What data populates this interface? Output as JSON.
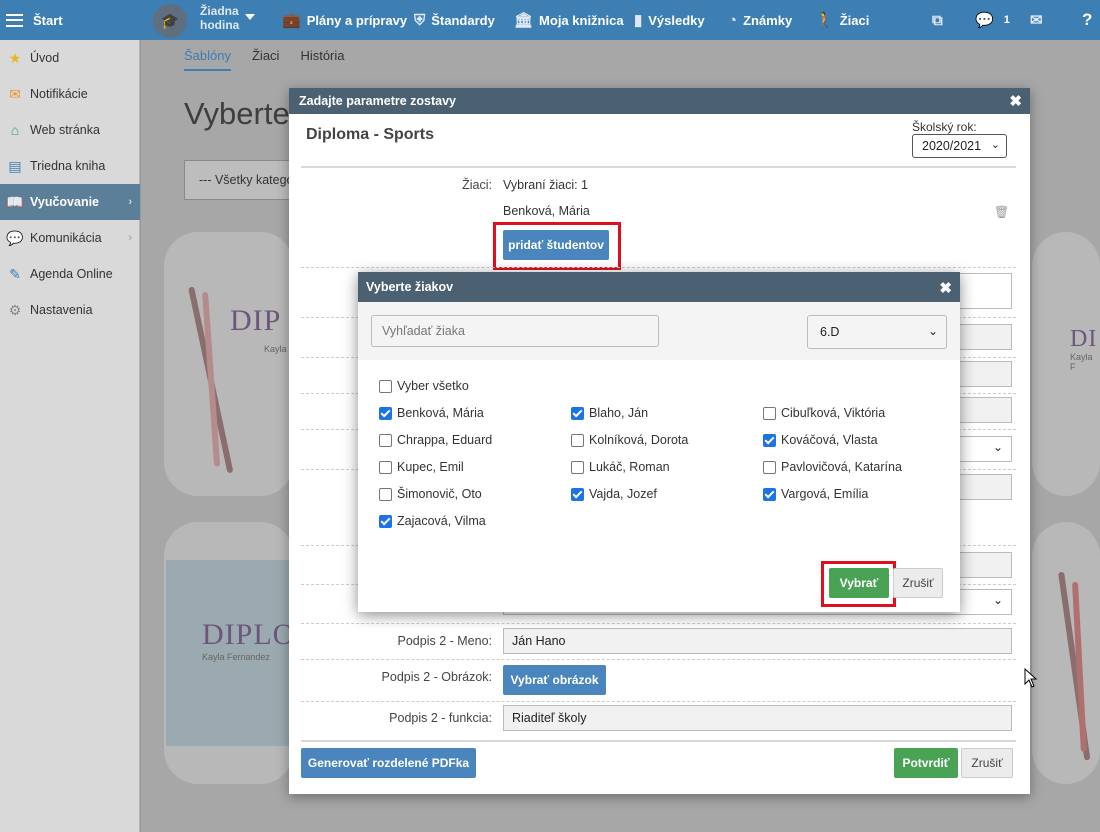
{
  "topbar": {
    "start": "Štart",
    "hodina": "Žiadna hodina",
    "items": [
      {
        "label": "Plány a prípravy",
        "icon": "briefcase-icon"
      },
      {
        "label": "Štandardy",
        "icon": "shield-icon"
      },
      {
        "label": "Moja knižnica",
        "icon": "library-icon"
      },
      {
        "label": "Výsledky",
        "icon": "bar-chart-icon"
      },
      {
        "label": "Známky",
        "icon": "grades-icon"
      },
      {
        "label": "Žiaci",
        "icon": "students-icon"
      }
    ],
    "messages_count": "1",
    "help": "?"
  },
  "sidebar": {
    "items": [
      {
        "label": "Úvod",
        "icon": "star-icon"
      },
      {
        "label": "Notifikácie",
        "icon": "envelope-icon"
      },
      {
        "label": "Web stránka",
        "icon": "home-icon"
      },
      {
        "label": "Triedna kniha",
        "icon": "book-icon"
      },
      {
        "label": "Vyučovanie",
        "icon": "open-book-icon",
        "active": true
      },
      {
        "label": "Komunikácia",
        "icon": "chat-icon"
      },
      {
        "label": "Agenda Online",
        "icon": "pen-icon"
      },
      {
        "label": "Nastavenia",
        "icon": "gear-icon"
      }
    ]
  },
  "page": {
    "tabs": [
      "Šablóny",
      "Žiaci",
      "História"
    ],
    "title": "Vyberte",
    "category_select": "--- Všetky kategó"
  },
  "cards": {
    "dip_text": "DIPLO",
    "dip_text_short": "DIP",
    "dip_text_right": "DI",
    "name_text": "Kayla Fernandez",
    "name_short": "Kayla",
    "name_right": "Kayla F"
  },
  "modal": {
    "header": "Zadajte parametre zostavy",
    "title": "Diploma - Sports",
    "year_label": "Školský rok:",
    "year_value": "2020/2021",
    "students_label": "Žiaci:",
    "students_selected": "Vybraní žiaci: 1",
    "student_name": "Benková, Mária",
    "add_students": "pridať študentov",
    "sig2_name_label": "Podpis 2 - Meno:",
    "sig2_name_value": "Ján Hano",
    "sig2_image_label": "Podpis 2 - Obrázok:",
    "sig2_image_button": "Vybrať obrázok",
    "sig2_func_label": "Podpis 2 - funkcia:",
    "sig2_func_value": "Riaditeľ školy",
    "generate_button": "Generovať rozdelené PDFka",
    "confirm_button": "Potvrdiť",
    "cancel_button": "Zrušiť"
  },
  "picker": {
    "header": "Vyberte žiakov",
    "search_placeholder": "Vyhľadať žiaka",
    "class_value": "6.D",
    "select_all": "Vyber všetko",
    "students": [
      {
        "name": "Benková, Mária",
        "checked": true
      },
      {
        "name": "Blaho, Ján",
        "checked": true
      },
      {
        "name": "Cibuľková, Viktória",
        "checked": false
      },
      {
        "name": "Chrappa, Eduard",
        "checked": false
      },
      {
        "name": "Kolníková, Dorota",
        "checked": false
      },
      {
        "name": "Kováčová, Vlasta",
        "checked": true
      },
      {
        "name": "Kupec, Emil",
        "checked": false
      },
      {
        "name": "Lukáč, Roman",
        "checked": false
      },
      {
        "name": "Pavlovičová, Katarína",
        "checked": false
      },
      {
        "name": "Šimonovič, Oto",
        "checked": false
      },
      {
        "name": "Vajda, Jozef",
        "checked": true
      },
      {
        "name": "Vargová, Emília",
        "checked": true
      },
      {
        "name": "Zajacová, Vilma",
        "checked": true
      }
    ],
    "select_button": "Vybrať",
    "cancel_button": "Zrušiť"
  },
  "colors": {
    "topbar": "#3d7eb3",
    "modal_header": "#4b6171",
    "primary_button": "#4a86bd",
    "success_button": "#4aa355",
    "highlight": "#e00f1e",
    "checkbox": "#1a73e8"
  }
}
